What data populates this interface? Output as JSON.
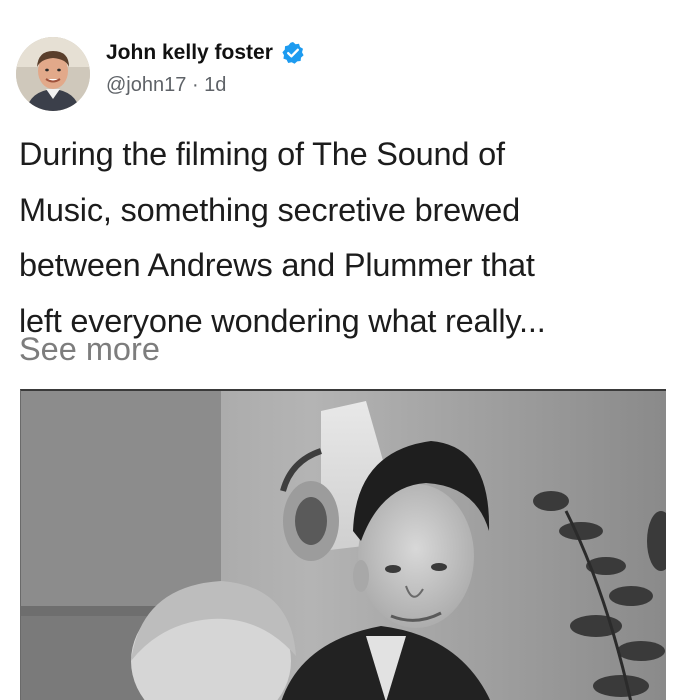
{
  "post": {
    "author": {
      "name": "John kelly foster",
      "verified": true,
      "handle": "@john17",
      "separator": "·",
      "time": "1d",
      "avatar_icon": "person-avatar"
    },
    "text_lines": [
      "During the filming of The Sound of",
      "Music, something secretive brewed",
      "between Andrews and Plummer that",
      "left everyone wondering what really..."
    ],
    "see_more_label": "See more",
    "image": {
      "kind": "black-and-white photograph",
      "subject": "man in suit with child in foreground"
    }
  },
  "colors": {
    "verified_badge": "#1d9bf0",
    "text": "#1c1c1c",
    "muted": "#5f6368",
    "see_more": "#7d7d7d"
  }
}
